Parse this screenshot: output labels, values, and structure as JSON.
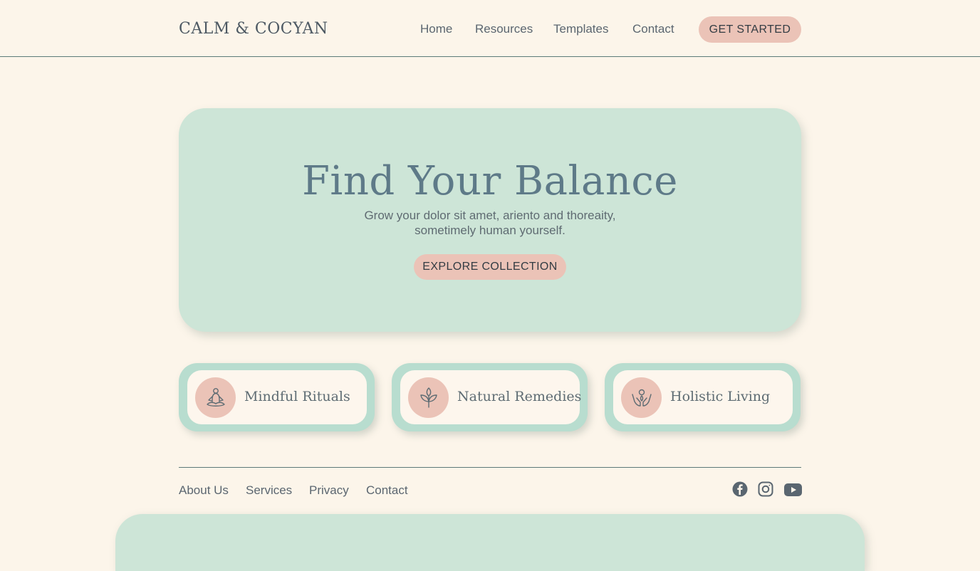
{
  "brand": {
    "logo": "CALM & COCYAN"
  },
  "nav": {
    "items": [
      "Home",
      "Resources",
      "Templates",
      "Contact"
    ],
    "cta": "GET STARTED"
  },
  "hero": {
    "title": "Find Your Balance",
    "subtitle_line1": "Grow your dolor sit amet, ariento and thoreaity,",
    "subtitle_line2": "sometimely human yourself.",
    "cta": "EXPLORE COLLECTION"
  },
  "features": [
    {
      "label": "Mindful Rituals",
      "icon": "meditation-icon"
    },
    {
      "label": "Natural Remedies",
      "icon": "leaf-icon"
    },
    {
      "label": "Holistic Living",
      "icon": "hands-icon"
    }
  ],
  "footer": {
    "links": [
      "About Us",
      "Services",
      "Privacy",
      "Contact"
    ],
    "social": [
      "facebook-icon",
      "instagram-icon",
      "youtube-icon"
    ]
  },
  "colors": {
    "background": "#fcf5ea",
    "mint": "#cde5d7",
    "peach": "#ebc3b7",
    "slate": "#5e7a88"
  }
}
